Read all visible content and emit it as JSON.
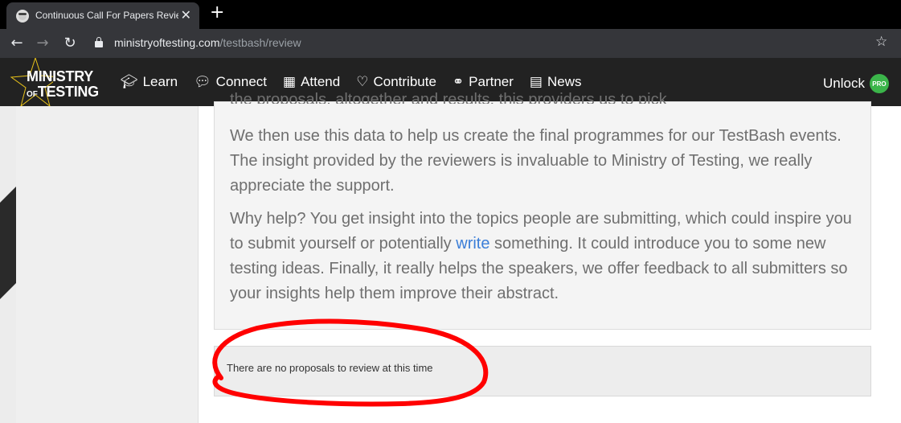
{
  "browser": {
    "tab_title": "Continuous Call For Papers Review",
    "tab_close": "✕",
    "new_tab": "+",
    "url_host": "ministryoftesting.com",
    "url_path": "/testbash/review"
  },
  "header": {
    "logo_line1": "MINISTRY",
    "logo_of": "OF",
    "logo_line2": "TESTING",
    "menu": [
      {
        "label": "Learn",
        "icon": "graduation-cap-icon"
      },
      {
        "label": "Connect",
        "icon": "chat-bubbles-icon"
      },
      {
        "label": "Attend",
        "icon": "calendar-icon"
      },
      {
        "label": "Contribute",
        "icon": "heart-icon"
      },
      {
        "label": "Partner",
        "icon": "handshake-icon"
      },
      {
        "label": "News",
        "icon": "newspaper-icon"
      }
    ],
    "unlock_label": "Unlock",
    "pro_badge": "PRO"
  },
  "main": {
    "partial_line": "the proposals, altogether and results, this providers us to pick",
    "paragraph1": "We then use this data to help us create the final programmes for our TestBash events. The insight provided by the reviewers is invaluable to Ministry of Testing, we really appreciate the support.",
    "paragraph2_before": "Why help? You get insight into the topics people are submitting, which could inspire you to submit yourself or potentially ",
    "paragraph2_link": "write",
    "paragraph2_after": " something. It could introduce you to some new testing ideas. Finally, it really helps the speakers, we offer feedback to all submitters so your insights help them improve their abstract.",
    "notice": "There are no proposals to review at this time"
  },
  "colors": {
    "header_bg": "#222222",
    "link": "#3b7ed8",
    "pro_badge": "#3bb54a",
    "annotation": "#ff0000"
  }
}
